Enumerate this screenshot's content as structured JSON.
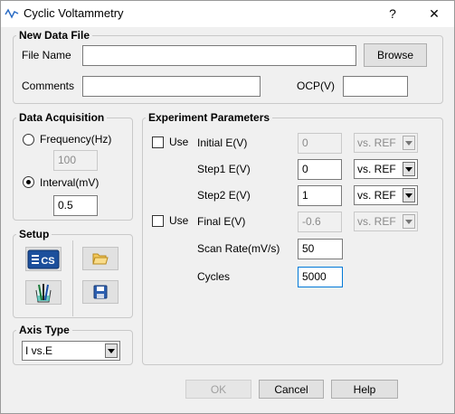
{
  "window": {
    "title": "Cyclic Voltammetry",
    "help_glyph": "?",
    "close_glyph": "✕",
    "app_icon": "cv-waveform-icon"
  },
  "new_data_file": {
    "legend": "New Data File",
    "file_name_label": "File Name",
    "file_name_value": "",
    "browse_label": "Browse",
    "comments_label": "Comments",
    "comments_value": "",
    "ocp_label": "OCP(V)",
    "ocp_value": ""
  },
  "data_acquisition": {
    "legend": "Data Acquisition",
    "frequency_label": "Frequency(Hz)",
    "frequency_value": "100",
    "frequency_selected": false,
    "interval_label": "Interval(mV)",
    "interval_value": "0.5",
    "interval_selected": true
  },
  "setup": {
    "legend": "Setup",
    "cs_badge_text": "CS",
    "buttons": [
      "cs-settings-icon",
      "open-folder-icon",
      "electrode-cell-icon",
      "save-disk-icon"
    ]
  },
  "axis_type": {
    "legend": "Axis Type",
    "selected": "I vs.E"
  },
  "experiment_parameters": {
    "legend": "Experiment Parameters",
    "use_label": "Use",
    "initial_e": {
      "label": "Initial E(V)",
      "value": "0",
      "ref": "vs. REF",
      "use_checked": false,
      "enabled": false
    },
    "step1_e": {
      "label": "Step1 E(V)",
      "value": "0",
      "ref": "vs. REF"
    },
    "step2_e": {
      "label": "Step2 E(V)",
      "value": "1",
      "ref": "vs. REF"
    },
    "final_e": {
      "label": "Final E(V)",
      "value": "-0.6",
      "ref": "vs. REF",
      "use_checked": false,
      "enabled": false
    },
    "scan_rate": {
      "label": "Scan Rate(mV/s)",
      "value": "50"
    },
    "cycles": {
      "label": "Cycles",
      "value": "5000"
    }
  },
  "footer": {
    "ok_label": "OK",
    "cancel_label": "Cancel",
    "help_label": "Help"
  },
  "colors": {
    "accent": "#0078d7",
    "cs_badge_bg": "#1c4f9c"
  }
}
